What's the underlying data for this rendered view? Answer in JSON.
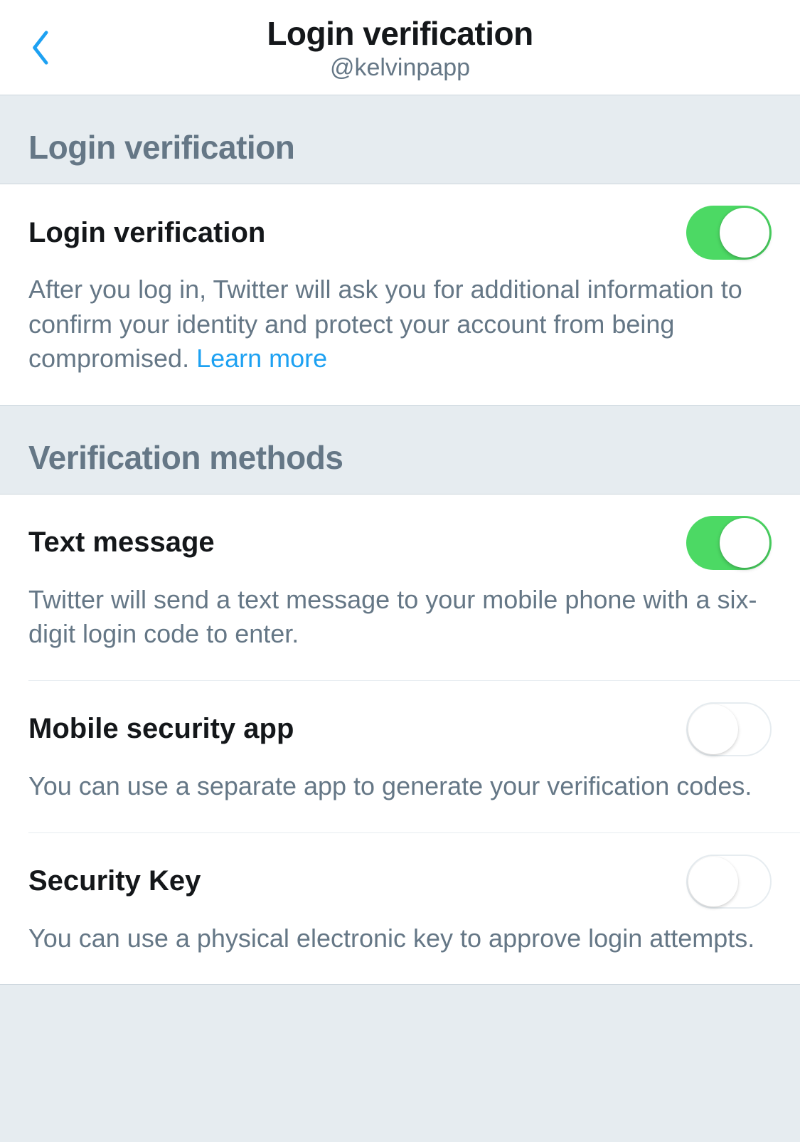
{
  "header": {
    "title": "Login verification",
    "subtitle": "@kelvinpapp"
  },
  "sections": {
    "login_verification": {
      "title": "Login verification",
      "setting": {
        "label": "Login verification",
        "description": "After you log in, Twitter will ask you for additional information to confirm your identity and protect your account from being compromised. ",
        "link_text": "Learn more",
        "enabled": true
      }
    },
    "verification_methods": {
      "title": "Verification methods",
      "methods": [
        {
          "label": "Text message",
          "description": "Twitter will send a text message to your mobile phone with a six-digit login code to enter.",
          "enabled": true
        },
        {
          "label": "Mobile security app",
          "description": "You can use a separate app to generate your verification codes.",
          "enabled": false
        },
        {
          "label": "Security Key",
          "description": "You can use a physical electronic key to approve login attempts.",
          "enabled": false
        }
      ]
    }
  }
}
